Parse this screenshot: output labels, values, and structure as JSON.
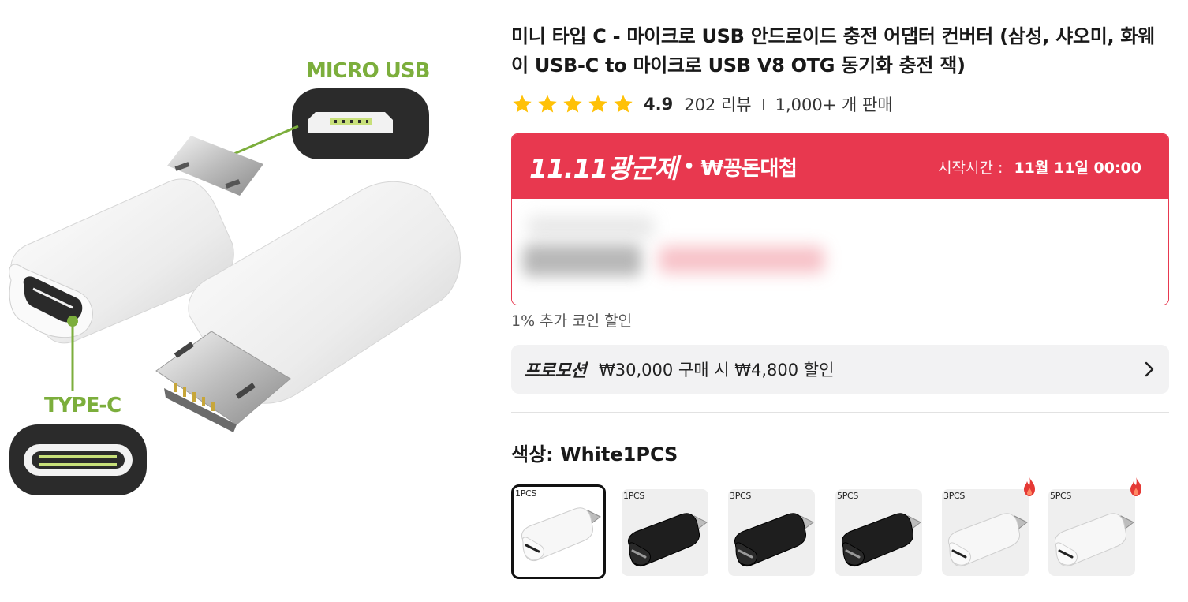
{
  "product_image": {
    "label_top": "MICRO USB",
    "label_bottom": "TYPE-C"
  },
  "product": {
    "title": "미니 타입 C - 마이크로 USB 안드로이드 충전 어댑터 컨버터 (삼성, 샤오미, 화웨이 USB-C to 마이크로 USB V8 OTG 동기화 충전 잭)",
    "rating": 5,
    "rating_text": "4.9",
    "reviews": "202 리뷰",
    "sales": "1,000+ 개 판매"
  },
  "promo_banner": {
    "logo_main": "11.11광군제",
    "logo_dot": "•",
    "logo_sub": "₩꽁돈대첩",
    "start_label": "시작시간 :",
    "start_value": "11월 11일 00:00",
    "accent_color": "#e8384f"
  },
  "coin_note": "1% 추가 코인 할인",
  "promotion": {
    "label": "프로모션",
    "text": "₩30,000 구매 시 ₩4,800 할인"
  },
  "color_option": {
    "label": "색상:",
    "selected": "White1PCS"
  },
  "swatches": [
    {
      "pcs": "1PCS",
      "color": "white",
      "selected": true,
      "hot": false
    },
    {
      "pcs": "1PCS",
      "color": "black",
      "selected": false,
      "hot": false
    },
    {
      "pcs": "3PCS",
      "color": "black",
      "selected": false,
      "hot": false
    },
    {
      "pcs": "5PCS",
      "color": "black",
      "selected": false,
      "hot": false
    },
    {
      "pcs": "3PCS",
      "color": "white",
      "selected": false,
      "hot": true
    },
    {
      "pcs": "5PCS",
      "color": "white",
      "selected": false,
      "hot": true
    }
  ]
}
